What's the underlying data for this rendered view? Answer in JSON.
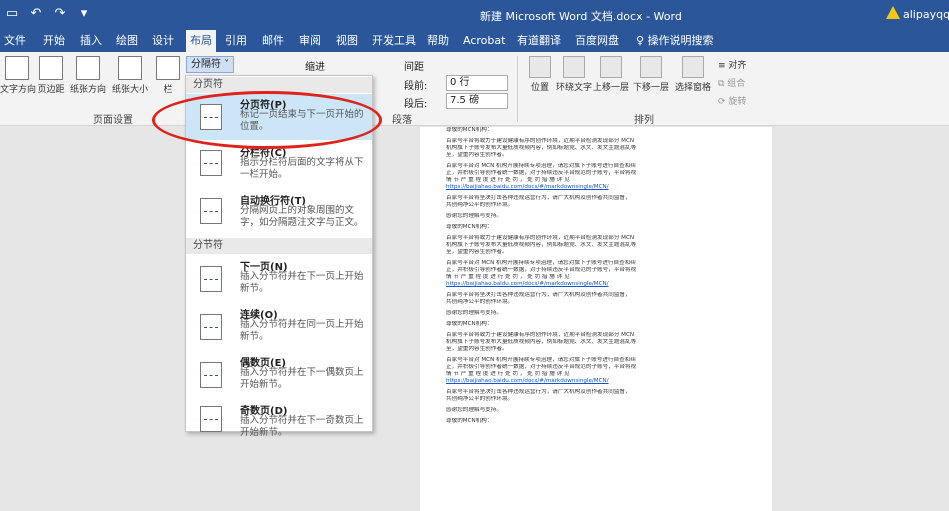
{
  "titlebar": {
    "qat": [
      "save-icon",
      "undo-icon",
      "redo-icon",
      "customize-icon"
    ],
    "title": "新建 Microsoft Word 文档.docx  -  Word",
    "user": "alipayqq"
  },
  "tabs": [
    "文件",
    "开始",
    "插入",
    "绘图",
    "设计",
    "布局",
    "引用",
    "邮件",
    "审阅",
    "视图",
    "开发工具",
    "帮助",
    "Acrobat",
    "有道翻译",
    "百度网盘"
  ],
  "active_tab": "布局",
  "tell_me": "操作说明搜索",
  "ribbon": {
    "page_setup": {
      "buttons": [
        "文字方向",
        "页边距",
        "纸张方向",
        "纸张大小",
        "栏"
      ],
      "label": "页面设置"
    },
    "breaks_label": "分隔符 ˅",
    "indent_label": "缩进",
    "spacing_label": "间距",
    "before_label": "段前:",
    "before_value": "0 行",
    "after_label": "段后:",
    "after_value": "7.5 磅",
    "paragraph_label": "段落",
    "arrange": {
      "buttons": [
        "位置",
        "环绕文字",
        "上移一层",
        "下移一层",
        "选择窗格"
      ],
      "align": "对齐",
      "group": "组合",
      "rotate": "旋转",
      "label": "排列"
    }
  },
  "menu": {
    "page_breaks_header": "分页符",
    "section_breaks_header": "分节符",
    "items": [
      {
        "title": "分页符(P)",
        "desc": "标记一页结束与下一页开始的位置。"
      },
      {
        "title": "分栏符(C)",
        "desc": "指示分栏符后面的文字将从下一栏开始。"
      },
      {
        "title": "自动换行符(T)",
        "desc": "分隔网页上的对象周围的文字，如分隔题注文字与正文。"
      },
      {
        "title": "下一页(N)",
        "desc": "插入分节符并在下一页上开始新节。"
      },
      {
        "title": "连续(O)",
        "desc": "插入分节符并在同一页上开始新节。"
      },
      {
        "title": "偶数页(E)",
        "desc": "插入分节符并在下一偶数页上开始新节。"
      },
      {
        "title": "奇数页(D)",
        "desc": "插入分节符并在下一奇数页上开始新节。"
      }
    ]
  },
  "document": {
    "lines": [
      "尊敬的MCN机构：",
      "百家号平台将致力于建设健康有序的创作环境，近期平台检测发现部分 MCN",
      "机构旗下子账号发布大量低质视频内容，例如标题党、水文、发文主题混乱等",
      "至，望重内容生创作者。",
      "百家号平台对 MCN 机构开展持续专项治理，请您对旗下子账号进行自查和纠",
      "正，并积极引导创作者统一数据，对于持续违反平台规范的子账号，平台将视",
      "情 节 严 重 程 度 进 行 处 罚 ， 处 罚 措 施 详 见",
      "https://baijiahao.baidu.com/docs/#/markdownsingle/MCN/",
      "百家号平台将坚决打击各种违规运营行为，请广大机构及创作者共同监督，",
      "共创纯净公平的创作环境。",
      "感谢您的理解与支持。",
      "尊敬的MCN机构：",
      "百家号平台将致力于建设健康有序的创作环境，近期平台检测发现部分 MCN",
      "机构旗下子账号发布大量低质视频内容，例如标题党、水文、发文主题混乱等",
      "至，望重内容生创作者。",
      "百家号平台对 MCN 机构开展持续专项治理，请您对旗下子账号进行自查和纠",
      "正，并积极引导创作者统一数据，对于持续违反平台规范的子账号，平台将视",
      "情 节 严 重 程 度 进 行 处 罚 ， 处 罚 措 施 详 见",
      "https://baijiahao.baidu.com/docs/#/markdownsingle/MCN/",
      "百家号平台将坚决打击各种违规运营行为，请广大机构及创作者共同监督，",
      "共创纯净公平的创作环境。",
      "感谢您的理解与支持。",
      "尊敬的MCN机构：",
      "百家号平台将致力于建设健康有序的创作环境，近期平台检测发现部分 MCN",
      "机构旗下子账号发布大量低质视频内容，例如标题党、水文、发文主题混乱等",
      "至，望重内容生创作者。",
      "百家号平台对 MCN 机构开展持续专项治理，请您对旗下子账号进行自查和纠",
      "正，并积极引导创作者统一数据，对于持续违反平台规范的子账号，平台将视",
      "情 节 严 重 程 度 进 行 处 罚 ， 处 罚 措 施 详 见",
      "https://baijiahao.baidu.com/docs/#/markdownsingle/MCN/",
      "百家号平台将坚决打击各种违规运营行为，请广大机构及创作者共同监督，",
      "共创纯净公平的创作环境。",
      "感谢您的理解与支持。",
      "尊敬的MCN机构："
    ]
  },
  "colors": {
    "brand": "#2b579a",
    "highlight": "#cde6f7",
    "annotation": "#e0221c"
  }
}
